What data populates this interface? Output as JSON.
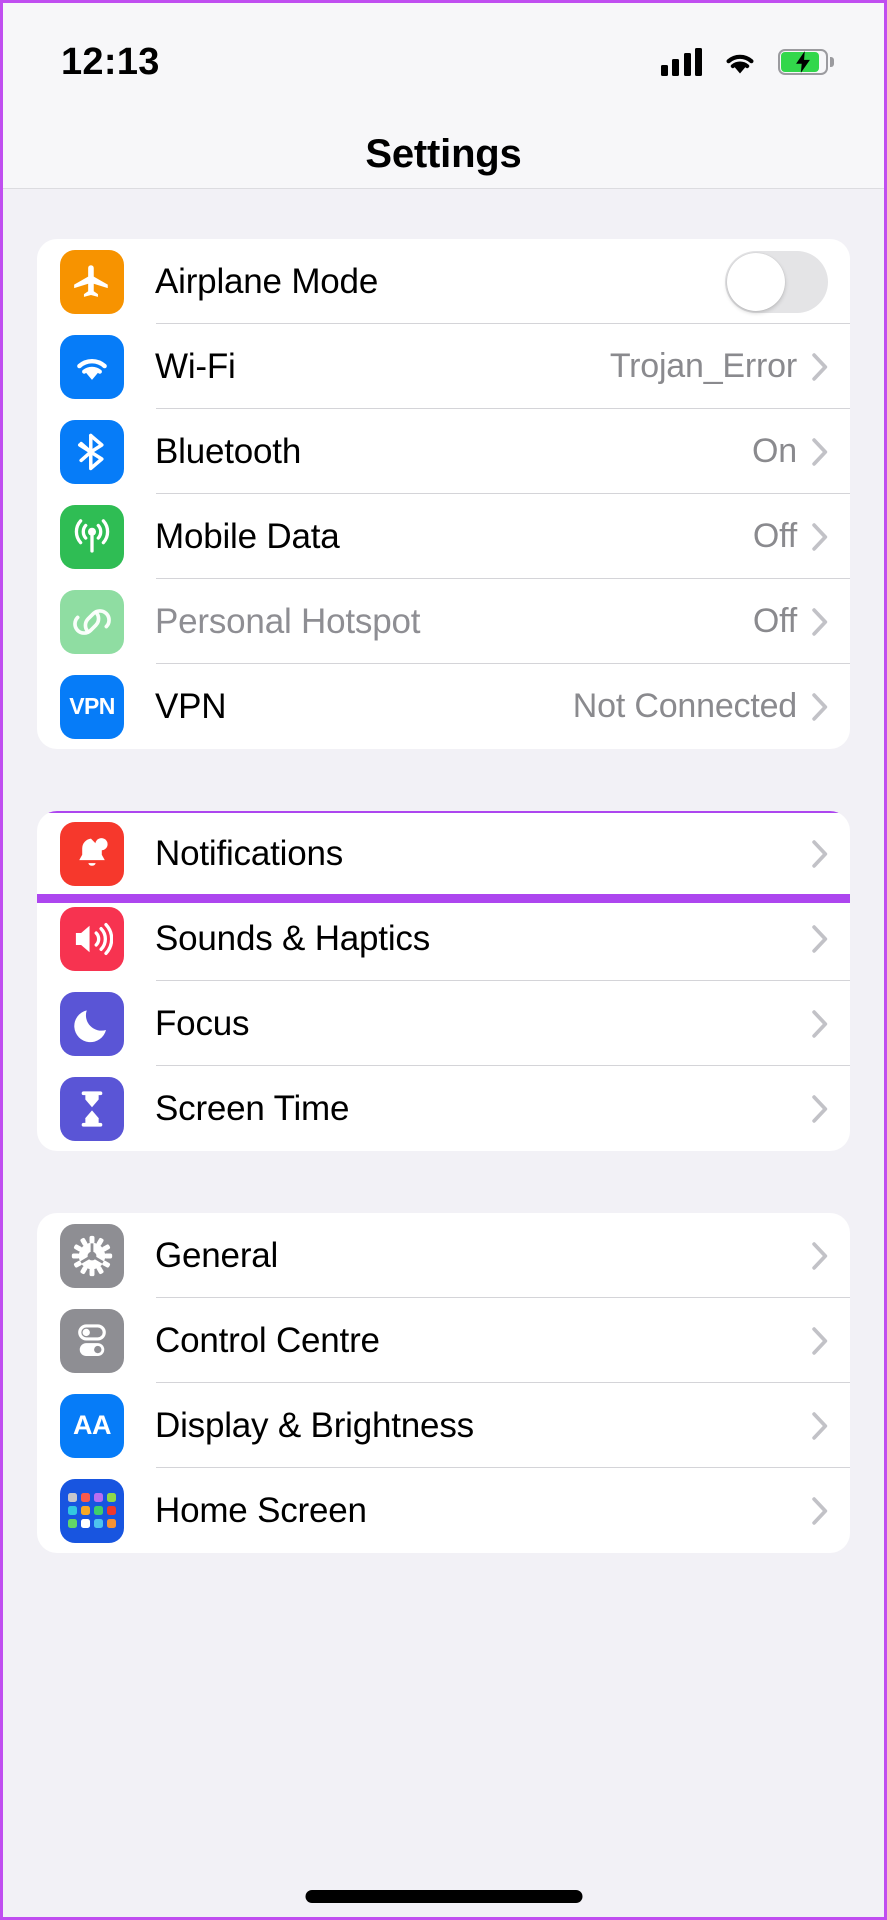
{
  "status_bar": {
    "time": "12:13",
    "signal_icon": "cellular-signal-icon",
    "wifi_icon": "wifi-icon",
    "battery_icon": "battery-charging-icon"
  },
  "nav": {
    "title": "Settings"
  },
  "colors": {
    "highlight": "#ad46ef",
    "page_background": "#f2f1f6",
    "card_background": "#ffffff",
    "value_text": "#8a8a8e",
    "accent_blue": "#007aff",
    "battery_green": "#32d74b"
  },
  "groups": [
    {
      "id": "connectivity",
      "rows": [
        {
          "label": "Airplane Mode",
          "icon": "airplane-icon",
          "icon_bg": "#f79300",
          "control": "toggle",
          "toggle_on": false,
          "value": "",
          "chevron": false,
          "disabled": false
        },
        {
          "label": "Wi-Fi",
          "icon": "wifi-icon",
          "icon_bg": "#067cf8",
          "control": "value",
          "value": "Trojan_Error",
          "chevron": true,
          "disabled": false
        },
        {
          "label": "Bluetooth",
          "icon": "bluetooth-icon",
          "icon_bg": "#067cf8",
          "control": "value",
          "value": "On",
          "chevron": true,
          "disabled": false
        },
        {
          "label": "Mobile Data",
          "icon": "cellular-tower-icon",
          "icon_bg": "#2fbd54",
          "control": "value",
          "value": "Off",
          "chevron": true,
          "disabled": false
        },
        {
          "label": "Personal Hotspot",
          "icon": "hotspot-link-icon",
          "icon_bg": "#8fdda2",
          "control": "value",
          "value": "Off",
          "chevron": true,
          "disabled": true
        },
        {
          "label": "VPN",
          "icon": "vpn-icon",
          "icon_bg": "#067cf8",
          "control": "value",
          "value": "Not Connected",
          "chevron": true,
          "disabled": false
        }
      ]
    },
    {
      "id": "alerts",
      "rows": [
        {
          "label": "Notifications",
          "icon": "notification-bell-icon",
          "icon_bg": "#f6382c",
          "control": "value",
          "value": "",
          "chevron": true,
          "disabled": false,
          "highlighted": true
        },
        {
          "label": "Sounds & Haptics",
          "icon": "speaker-waves-icon",
          "icon_bg": "#f73350",
          "control": "value",
          "value": "",
          "chevron": true,
          "disabled": false
        },
        {
          "label": "Focus",
          "icon": "moon-icon",
          "icon_bg": "#5a55d6",
          "control": "value",
          "value": "",
          "chevron": true,
          "disabled": false
        },
        {
          "label": "Screen Time",
          "icon": "hourglass-icon",
          "icon_bg": "#5a55d6",
          "control": "value",
          "value": "",
          "chevron": true,
          "disabled": false
        }
      ]
    },
    {
      "id": "system",
      "rows": [
        {
          "label": "General",
          "icon": "gear-icon",
          "icon_bg": "#8e8e93",
          "control": "value",
          "value": "",
          "chevron": true,
          "disabled": false
        },
        {
          "label": "Control Centre",
          "icon": "control-toggles-icon",
          "icon_bg": "#8e8e93",
          "control": "value",
          "value": "",
          "chevron": true,
          "disabled": false
        },
        {
          "label": "Display & Brightness",
          "icon": "display-aa-icon",
          "icon_bg": "#067cf8",
          "control": "value",
          "value": "",
          "chevron": true,
          "disabled": false
        },
        {
          "label": "Home Screen",
          "icon": "home-screen-grid-icon",
          "icon_bg": "#1855e0",
          "control": "value",
          "value": "",
          "chevron": true,
          "disabled": false
        }
      ]
    }
  ],
  "home_indicator": "home-indicator-bar"
}
